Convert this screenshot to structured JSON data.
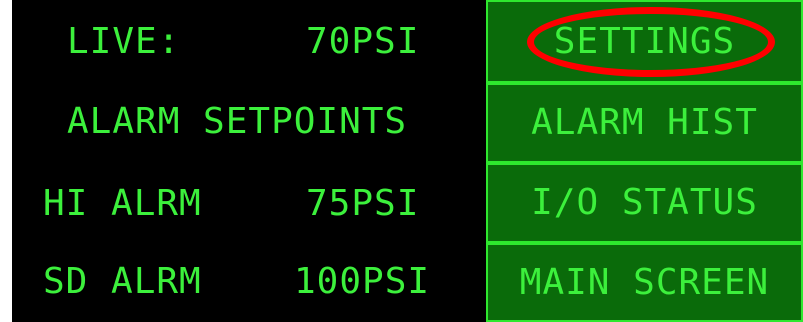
{
  "status": {
    "live_label": "LIVE:",
    "live_value": "70PSI"
  },
  "setpoints": {
    "heading": "ALARM SETPOINTS",
    "hi_alarm_label": "HI ALRM",
    "hi_alarm_value": "75PSI",
    "sd_alarm_label": "SD ALRM",
    "sd_alarm_value": "100PSI"
  },
  "menu": {
    "settings": "SETTINGS",
    "alarm_hist": "ALARM HIST",
    "io_status": "I/O STATUS",
    "main_screen": "MAIN SCREEN"
  },
  "colors": {
    "lcd_text": "#3cf03c",
    "button_fill": "#0a6b0a",
    "button_border": "#2ee82e",
    "background": "#000000",
    "highlight": "#ff0000"
  }
}
